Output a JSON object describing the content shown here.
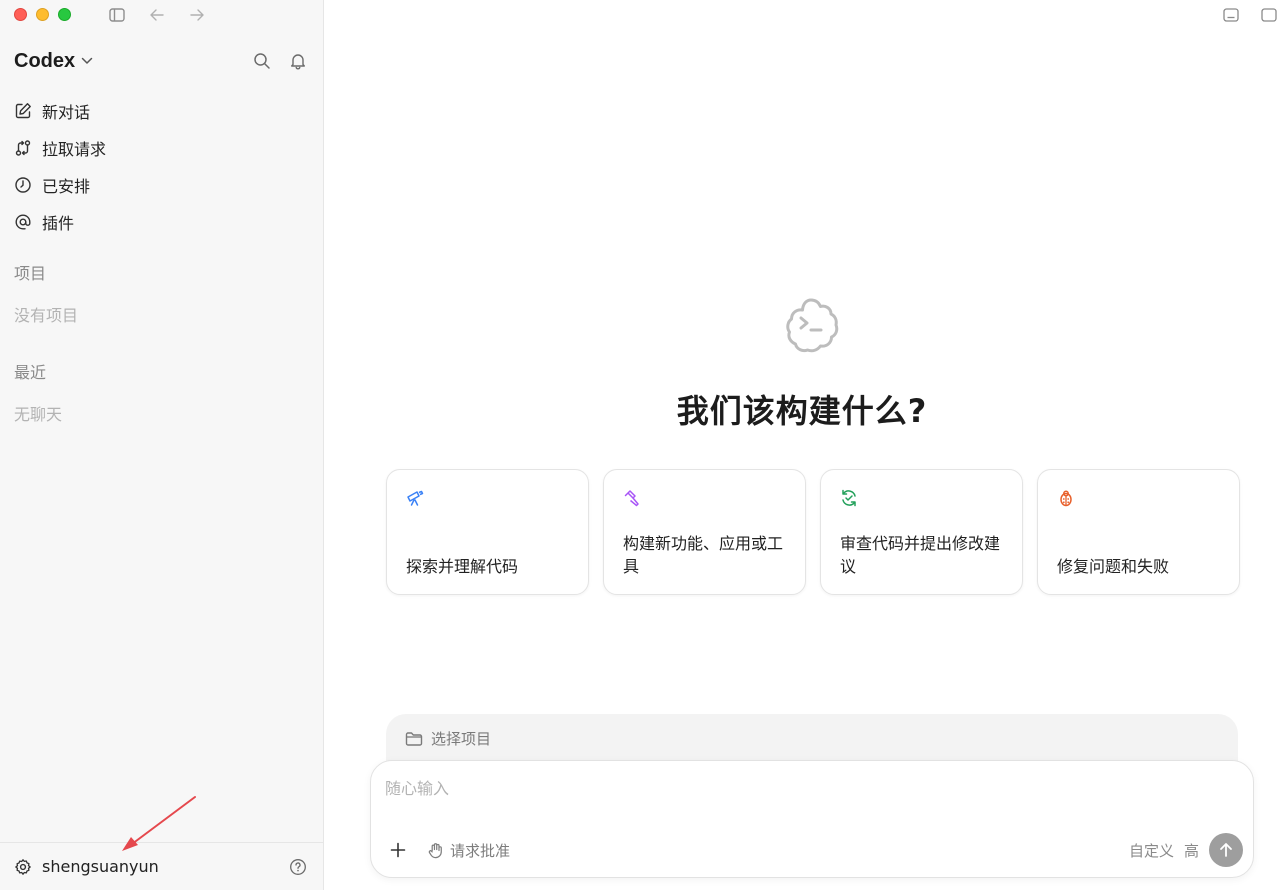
{
  "sidebar": {
    "brand": "Codex",
    "nav": [
      {
        "label": "新对话",
        "icon": "edit-icon"
      },
      {
        "label": "拉取请求",
        "icon": "pull-request-icon"
      },
      {
        "label": "已安排",
        "icon": "clock-icon"
      },
      {
        "label": "插件",
        "icon": "at-icon"
      }
    ],
    "projects_label": "项目",
    "projects_empty": "没有项目",
    "recent_label": "最近",
    "recent_empty": "无聊天",
    "user_name": "shengsuanyun"
  },
  "main": {
    "headline": "我们该构建什么?",
    "cards": [
      {
        "label": "探索并理解代码",
        "icon": "telescope-icon",
        "color": "#3b82f6"
      },
      {
        "label": "构建新功能、应用或工具",
        "icon": "hammer-icon",
        "color": "#a855f7"
      },
      {
        "label": "审查代码并提出修改建议",
        "icon": "review-icon",
        "color": "#22a05a"
      },
      {
        "label": "修复问题和失败",
        "icon": "bug-icon",
        "color": "#e8612c"
      }
    ],
    "project_selector": "选择项目",
    "composer": {
      "placeholder": "随心输入",
      "approval": "请求批准",
      "custom": "自定义",
      "level": "高"
    }
  },
  "colors": {
    "sidebar_bg": "#f7f7f7",
    "annotation_arrow": "#e5484d",
    "send_button": "#9e9e9e"
  }
}
